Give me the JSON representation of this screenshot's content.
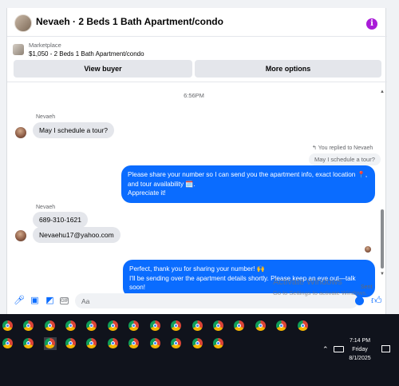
{
  "header": {
    "title": "Nevaeh · 2 Beds 1 Bath Apartment/condo",
    "info_icon": "i"
  },
  "listing": {
    "label": "Marketplace",
    "title": "$1,050 - 2 Beds 1 Bath Apartment/condo"
  },
  "actions": {
    "view_buyer": "View buyer",
    "more_options": "More options"
  },
  "conversation": {
    "timestamp": "6:56PM",
    "sender": "Nevaeh",
    "msg1": "May I schedule a tour?",
    "reply_note": "You replied to Nevaeh",
    "reply_quote": "May I schedule a tour?",
    "out1_line1": "Please share your number so I can send you the apartment info, exact location 📍,",
    "out1_line2": "and tour availability 🗓️.",
    "out1_line3": "Appreciate it!",
    "sender2": "Nevaeh",
    "msg2": "689-310-1621",
    "msg3": "Nevaehu17@yahoo.com",
    "out2_line1": "Perfect, thank you for sharing your number! 🙌",
    "out2_line2": "I'll be sending over the apartment details shortly. Please keep an eye out—talk soon!",
    "status": "Sent"
  },
  "composer": {
    "placeholder": "Aa"
  },
  "watermark": {
    "title": "Activate Windows",
    "subtitle": "Go to Settings to activate Windows."
  },
  "taskbar": {
    "time": "7:14 PM",
    "day": "Friday",
    "date": "8/1/2025"
  },
  "icons": {
    "app": "chrome-icon",
    "accent": "#0a6cff",
    "info": "#a91bd8"
  }
}
